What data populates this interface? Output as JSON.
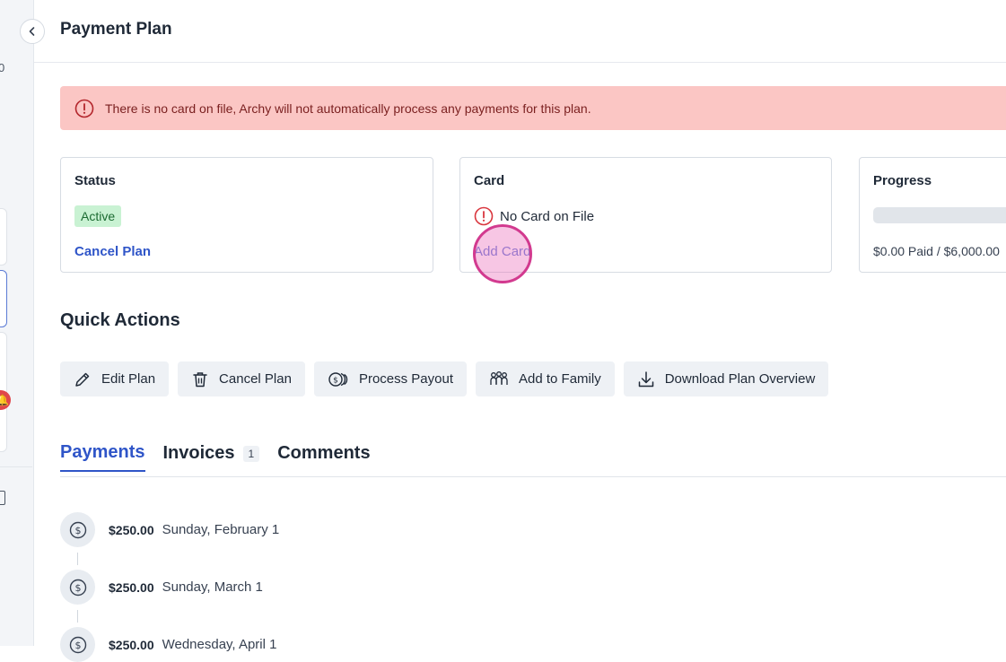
{
  "page": {
    "title": "Payment Plan"
  },
  "left_strip": {
    "partial_text": "0"
  },
  "alert": {
    "message": "There is no card on file, Archy will not automatically process any payments for this plan.",
    "color": "#fbc6c4"
  },
  "status_card": {
    "title": "Status",
    "status": "Active",
    "cancel_link": "Cancel Plan"
  },
  "card_card": {
    "title": "Card",
    "no_card_text": "No Card on File",
    "add_card_link": "Add Card"
  },
  "progress_card": {
    "title": "Progress",
    "summary": "$0.00 Paid / $6,000.00",
    "progress_fraction": 0
  },
  "quick_actions": {
    "title": "Quick Actions",
    "buttons": [
      {
        "label": "Edit Plan",
        "icon": "pencil-icon"
      },
      {
        "label": "Cancel Plan",
        "icon": "trash-icon"
      },
      {
        "label": "Process Payout",
        "icon": "money-icon"
      },
      {
        "label": "Add to Family",
        "icon": "family-icon"
      },
      {
        "label": "Download Plan Overview",
        "icon": "download-icon"
      }
    ]
  },
  "tabs": [
    {
      "label": "Payments",
      "active": true
    },
    {
      "label": "Invoices",
      "count": "1",
      "active": false
    },
    {
      "label": "Comments",
      "active": false
    }
  ],
  "payments": [
    {
      "amount": "$250.00",
      "date": "Sunday, February 1"
    },
    {
      "amount": "$250.00",
      "date": "Sunday, March 1"
    },
    {
      "amount": "$250.00",
      "date": "Wednesday, April 1"
    }
  ],
  "colors": {
    "accent": "#2f55c8",
    "active_green_bg": "#c9f2d3",
    "danger": "#d9363e"
  }
}
